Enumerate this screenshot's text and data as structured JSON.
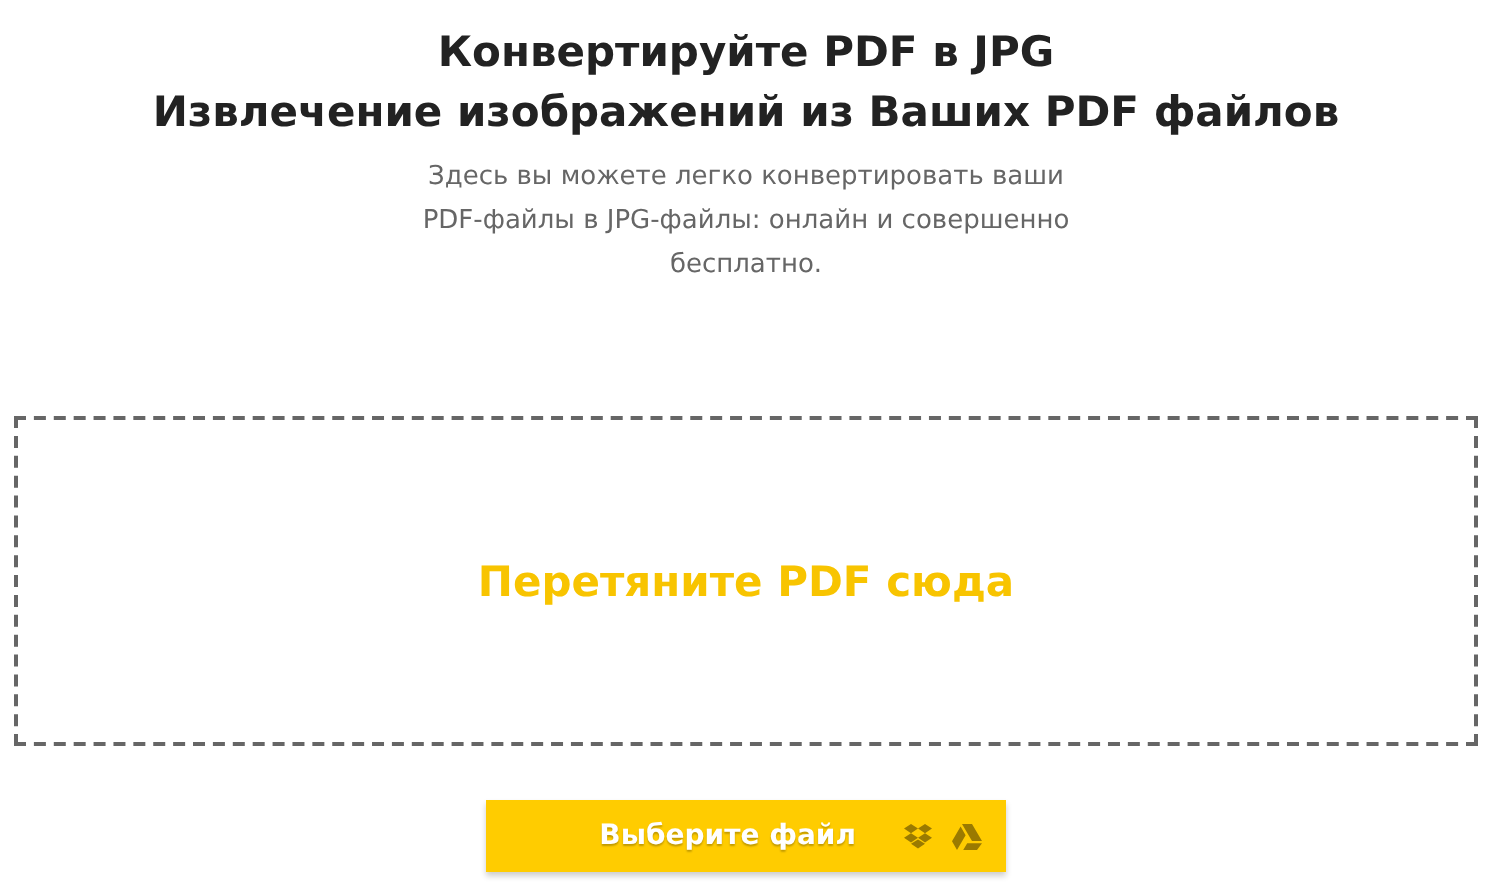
{
  "header": {
    "title": "Конвертируйте PDF в JPG",
    "subtitle": "Извлечение изображений из Ваших PDF файлов",
    "description": "Здесь вы можете легко конвертировать ваши PDF-файлы в JPG-файлы: онлайн и совершенно бесплатно."
  },
  "drop_zone": {
    "label": "Перетяните PDF сюда"
  },
  "upload_button": {
    "label": "Выберите файл"
  }
}
